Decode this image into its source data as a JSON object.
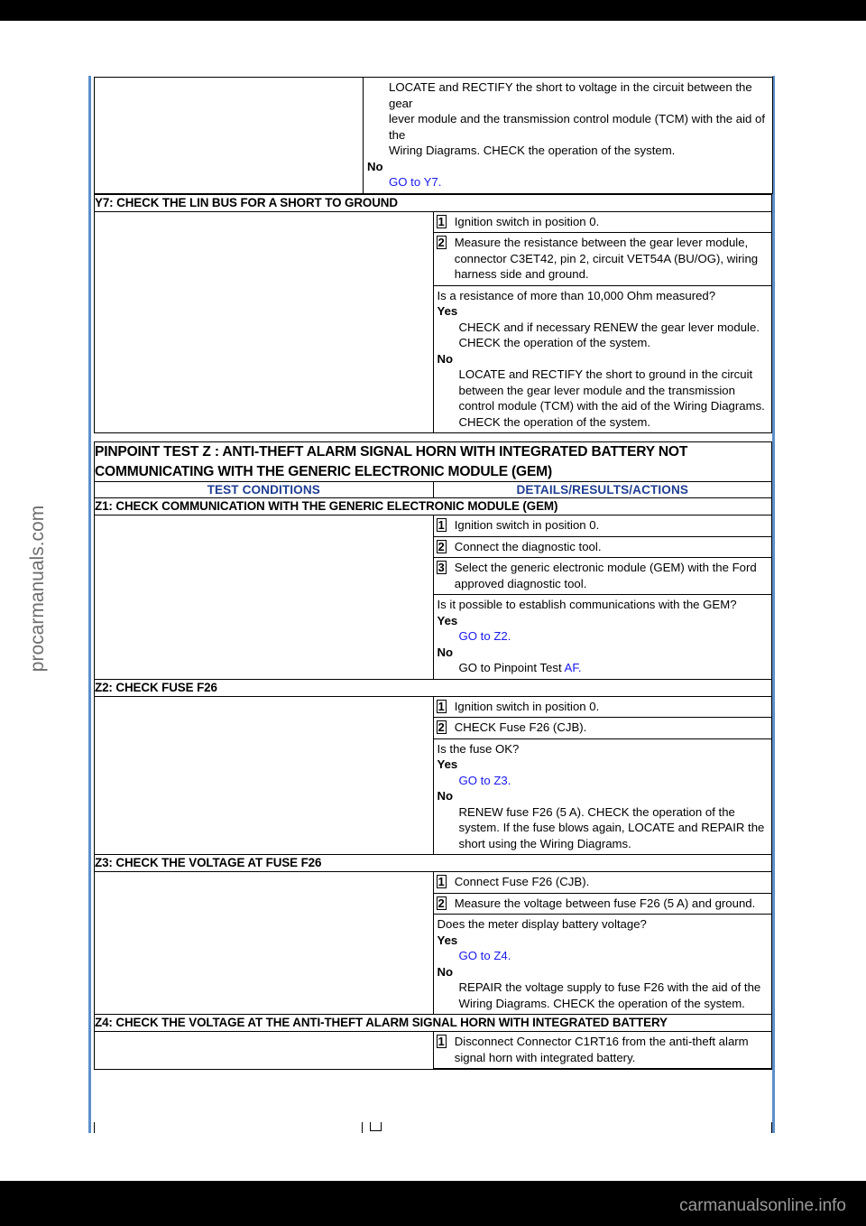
{
  "page": {
    "watermark": "procarmanuals.com",
    "footer_text": "carmanualsonline.info",
    "link_color": "#1818ee",
    "header_color": "#1f3e91"
  },
  "continued_block": {
    "no_label": "No",
    "no_action_lines": [
      "LOCATE and RECTIFY the short to voltage in the circuit between the gear",
      "lever module and the transmission control module (TCM) with the aid of the",
      "Wiring Diagrams. CHECK the operation of the system."
    ],
    "goto_link": "GO to Y7."
  },
  "y7": {
    "title": "Y7: CHECK THE LIN BUS FOR A SHORT TO GROUND",
    "steps": [
      {
        "num": "1",
        "text": "Ignition switch in position 0."
      },
      {
        "num": "2",
        "text": "Measure the resistance between the gear lever module, connector C3ET42, pin 2, circuit VET54A (BU/OG), wiring harness side and ground."
      }
    ],
    "question": "Is a resistance of more than 10,000 Ohm measured?",
    "yes_label": "Yes",
    "yes_action": "CHECK and if necessary RENEW the gear lever module. CHECK the operation of the system.",
    "no_label": "No",
    "no_action": "LOCATE and RECTIFY the short to ground in the circuit between the gear lever module and the transmission control module (TCM) with the aid of the Wiring Diagrams. CHECK the operation of the system."
  },
  "pinpoint": {
    "title": "PINPOINT TEST Z : ANTI-THEFT ALARM SIGNAL HORN WITH INTEGRATED BATTERY NOT COMMUNICATING WITH THE GENERIC ELECTRONIC MODULE (GEM)",
    "col_headers": {
      "left": "TEST CONDITIONS",
      "right": "DETAILS/RESULTS/ACTIONS"
    }
  },
  "z1": {
    "title": "Z1: CHECK COMMUNICATION WITH THE GENERIC ELECTRONIC MODULE (GEM)",
    "steps": [
      {
        "num": "1",
        "text": "Ignition switch in position 0."
      },
      {
        "num": "2",
        "text": "Connect the diagnostic tool."
      },
      {
        "num": "3",
        "text": "Select the generic electronic module (GEM) with the Ford approved diagnostic tool."
      }
    ],
    "question": "Is it possible to establish communications with the GEM?",
    "yes_label": "Yes",
    "yes_action_link": "GO to Z2.",
    "no_label": "No",
    "no_action_prefix": "GO to Pinpoint Test ",
    "no_action_link": "AF."
  },
  "z2": {
    "title": "Z2: CHECK FUSE F26",
    "steps": [
      {
        "num": "1",
        "text": "Ignition switch in position 0."
      },
      {
        "num": "2",
        "text": "CHECK Fuse F26 (CJB)."
      }
    ],
    "question": "Is the fuse OK?",
    "yes_label": "Yes",
    "yes_action_link": "GO to Z3.",
    "no_label": "No",
    "no_action": "RENEW fuse F26 (5 A). CHECK the operation of the system. If the fuse blows again, LOCATE and REPAIR the short using the Wiring Diagrams."
  },
  "z3": {
    "title": "Z3: CHECK THE VOLTAGE AT FUSE F26",
    "steps": [
      {
        "num": "1",
        "text": "Connect Fuse F26 (CJB)."
      },
      {
        "num": "2",
        "text": "Measure the voltage between fuse F26 (5 A) and ground."
      }
    ],
    "question": "Does the meter display battery voltage?",
    "yes_label": "Yes",
    "yes_action_link": "GO to Z4.",
    "no_label": "No",
    "no_action": "REPAIR the voltage supply to fuse F26 with the aid of the Wiring Diagrams. CHECK the operation of the system."
  },
  "z4": {
    "title": "Z4: CHECK THE VOLTAGE AT THE ANTI-THEFT ALARM SIGNAL HORN WITH INTEGRATED BATTERY",
    "steps": [
      {
        "num": "1",
        "text": "Disconnect Connector C1RT16 from the anti-theft alarm signal horn with integrated battery."
      }
    ]
  }
}
